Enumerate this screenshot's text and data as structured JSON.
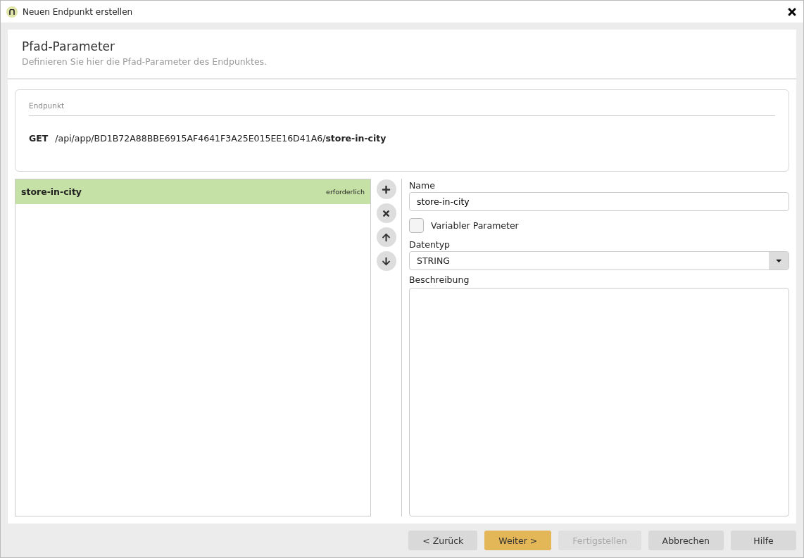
{
  "window": {
    "title": "Neuen Endpunkt erstellen"
  },
  "header": {
    "title": "Pfad-Parameter",
    "subtitle": "Definieren Sie hier die Pfad-Parameter des Endpunktes."
  },
  "endpoint": {
    "label": "Endpunkt",
    "method": "GET",
    "path": "/api/app/BD1B72A88BBE6915AF4641F3A25E015EE16D41A6/**store-in-city**"
  },
  "parameters": [
    {
      "name": "store-in-city",
      "badge": "erforderlich",
      "selected": true
    }
  ],
  "form": {
    "name_label": "Name",
    "name_value": "store-in-city",
    "variable_label": "Variabler Parameter",
    "variable_checked": false,
    "type_label": "Datentyp",
    "type_value": "STRING",
    "description_label": "Beschreibung"
  },
  "buttons": [
    {
      "label": "< Zurück",
      "kind": "default",
      "disabled": false
    },
    {
      "label": "Weiter >",
      "kind": "primary",
      "disabled": false
    },
    {
      "label": "Fertigstellen",
      "kind": "default",
      "disabled": true
    },
    {
      "label": "Abbrechen",
      "kind": "default",
      "disabled": false
    },
    {
      "label": "Hilfe",
      "kind": "default",
      "disabled": false
    }
  ]
}
